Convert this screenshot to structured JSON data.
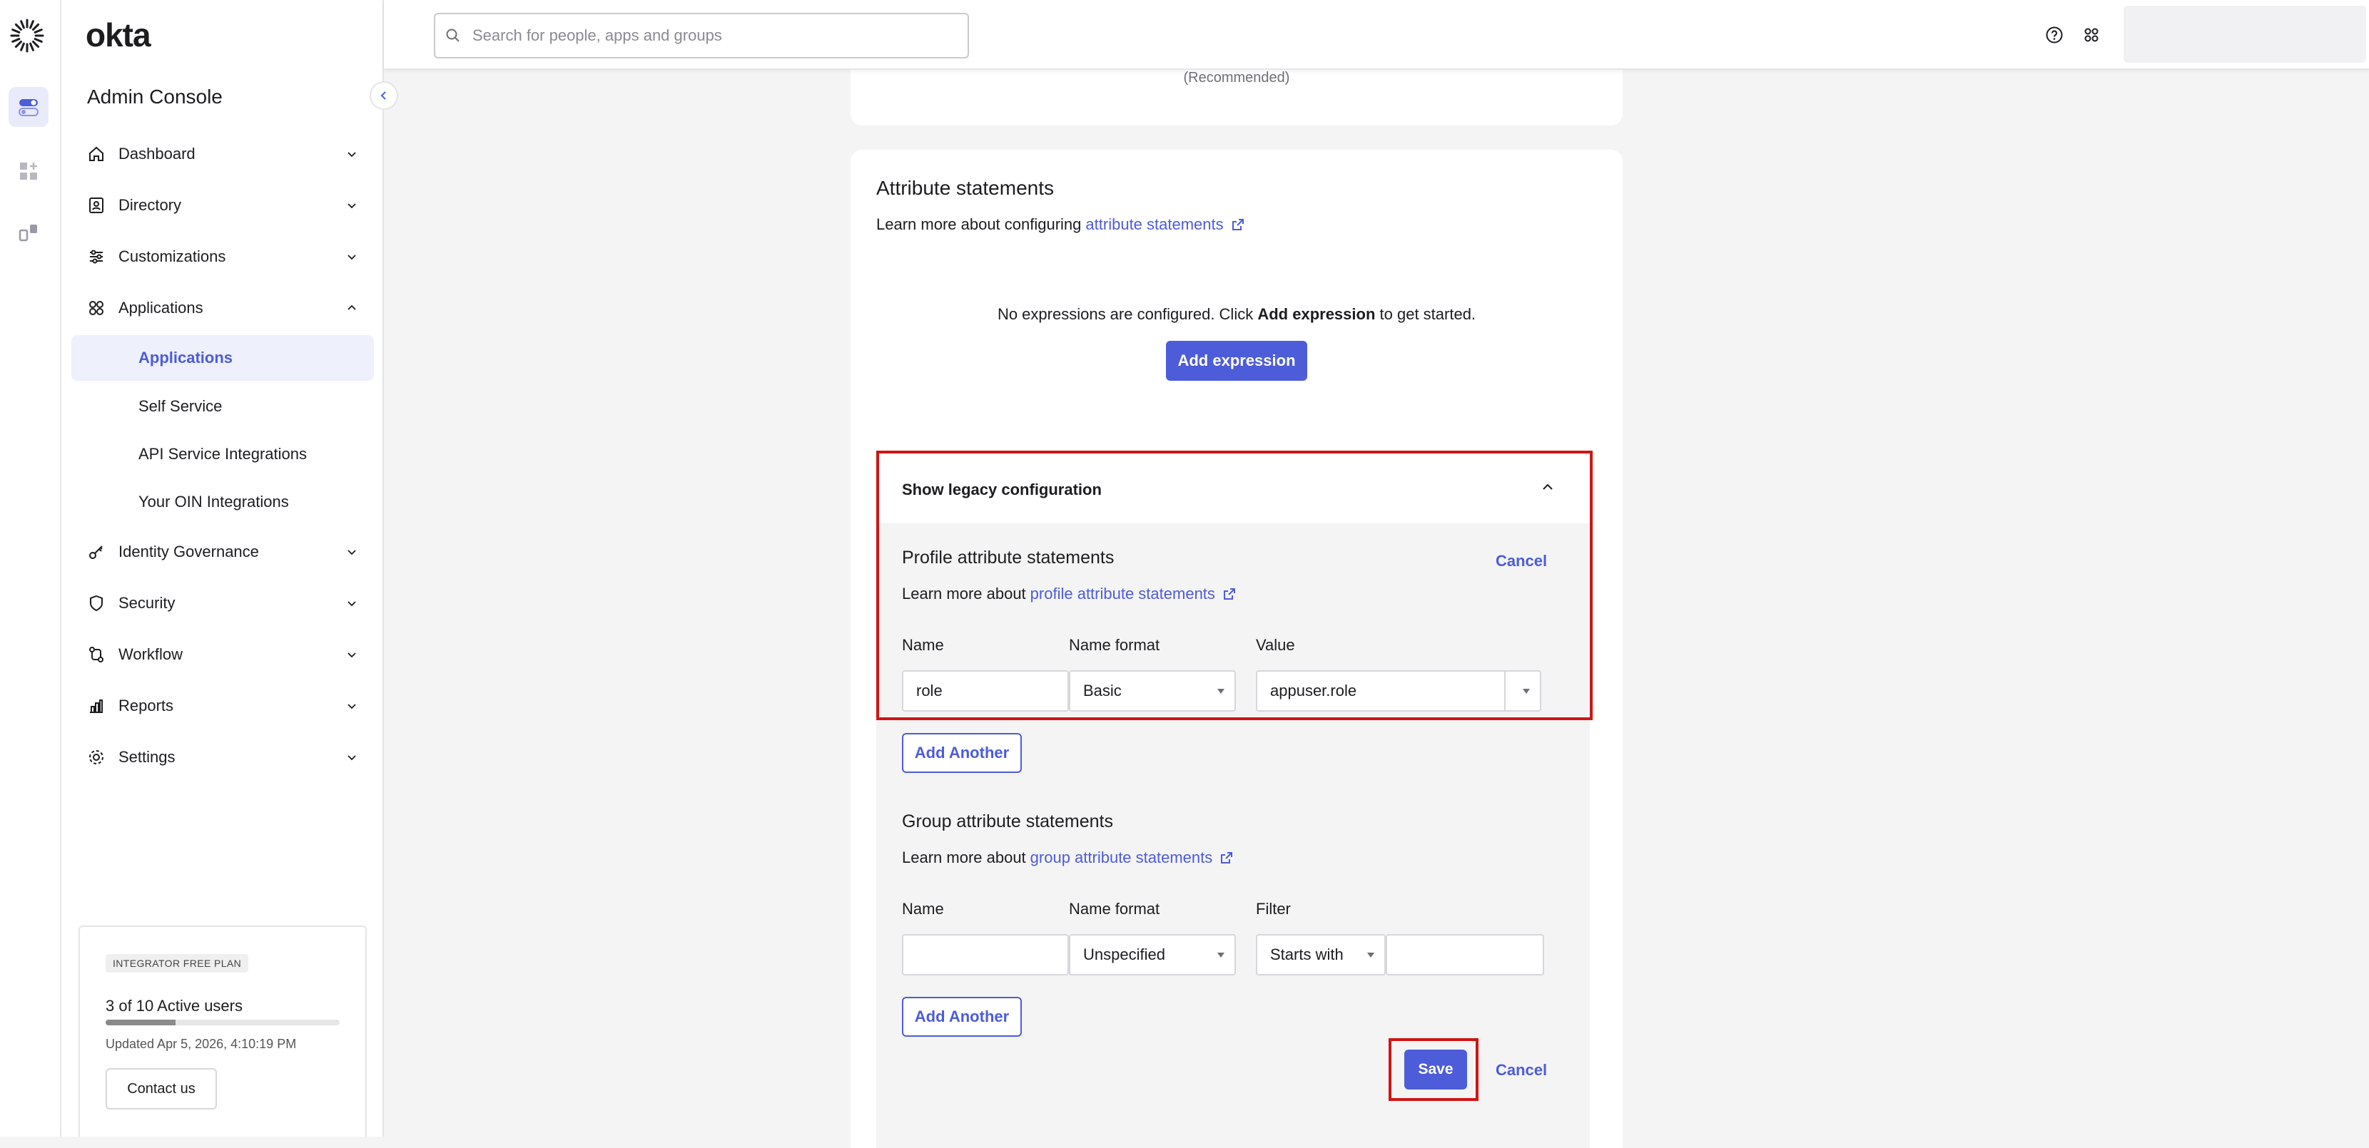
{
  "brand": {
    "wordmark": "okta",
    "console_title": "Admin Console",
    "accent": "#4d5cd8",
    "highlight_color": "#d11414"
  },
  "rail": {
    "items": [
      {
        "icon": "toggle-icon",
        "active": true
      },
      {
        "icon": "add-apps-icon",
        "active": false
      },
      {
        "icon": "integrations-icon",
        "active": false
      }
    ]
  },
  "search": {
    "placeholder": "Search for people, apps and groups",
    "value": ""
  },
  "topbar": {
    "icons": [
      "help-icon",
      "apps-grid-icon"
    ]
  },
  "sidebar": {
    "nav": [
      {
        "label": "Dashboard",
        "icon": "home-icon",
        "expanded": false
      },
      {
        "label": "Directory",
        "icon": "directory-icon",
        "expanded": false
      },
      {
        "label": "Customizations",
        "icon": "sliders-icon",
        "expanded": false
      },
      {
        "label": "Applications",
        "icon": "grid-icon",
        "expanded": true
      },
      {
        "label": "Identity Governance",
        "icon": "key-icon",
        "expanded": false
      },
      {
        "label": "Security",
        "icon": "shield-icon",
        "expanded": false
      },
      {
        "label": "Workflow",
        "icon": "workflow-icon",
        "expanded": false
      },
      {
        "label": "Reports",
        "icon": "chart-icon",
        "expanded": false
      },
      {
        "label": "Settings",
        "icon": "gear-icon",
        "expanded": false
      }
    ],
    "applications_sub": [
      {
        "label": "Applications",
        "active": true
      },
      {
        "label": "Self Service",
        "active": false
      },
      {
        "label": "API Service Integrations",
        "active": false
      },
      {
        "label": "Your OIN Integrations",
        "active": false
      }
    ],
    "plan": {
      "badge": "INTEGRATOR FREE PLAN",
      "users": "3 of 10 Active users",
      "progress": 0.3,
      "updated": "Updated Apr 5, 2026, 4:10:19 PM",
      "contact_label": "Contact us"
    }
  },
  "main": {
    "recommended": "(Recommended)",
    "attr": {
      "title": "Attribute statements",
      "learn_prefix": "Learn more about configuring",
      "learn_link": "attribute statements",
      "empty_prefix": "No expressions are configured. Click",
      "empty_bold": "Add expression",
      "empty_suffix": "to get started.",
      "add_expression": "Add expression"
    },
    "legacy": {
      "toggle_label": "Show legacy configuration",
      "profile": {
        "title": "Profile attribute statements",
        "cancel": "Cancel",
        "learn_prefix": "Learn more about",
        "learn_link": "profile attribute statements",
        "col_name": "Name",
        "col_format": "Name format",
        "col_value": "Value",
        "name": "role",
        "format": "Basic",
        "value": "appuser.role",
        "add_another": "Add Another"
      },
      "group": {
        "title": "Group attribute statements",
        "learn_prefix": "Learn more about",
        "learn_link": "group attribute statements",
        "col_name": "Name",
        "col_format": "Name format",
        "col_filter": "Filter",
        "name": "",
        "format": "Unspecified",
        "filter_op": "Starts with",
        "filter_value": "",
        "add_another": "Add Another"
      },
      "save": "Save",
      "cancel": "Cancel"
    }
  }
}
